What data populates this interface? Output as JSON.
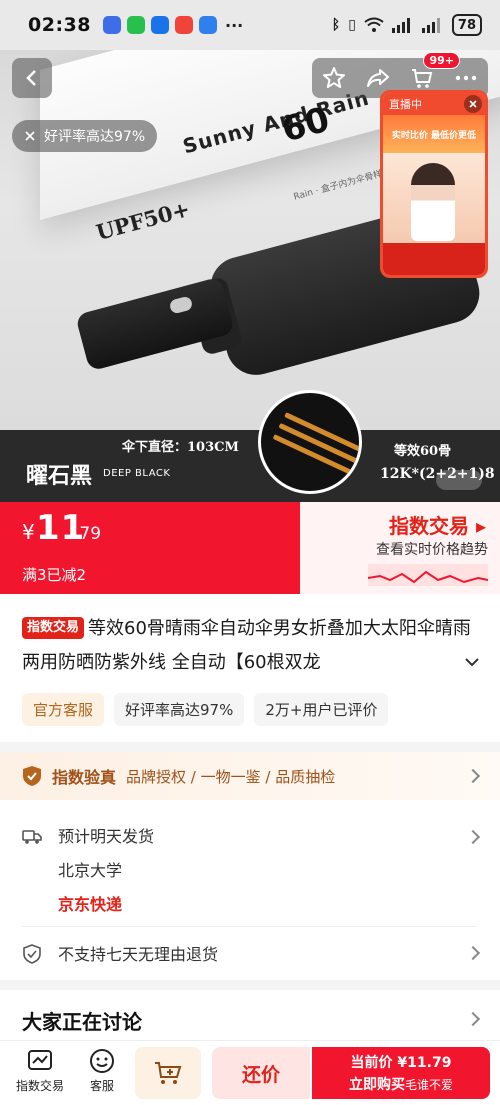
{
  "status_bar": {
    "time": "02:38",
    "battery": "78",
    "more": "···"
  },
  "hero": {
    "rating_tip": "好评率高达97%",
    "cart_badge": "99+",
    "box_brand": "UPF50+",
    "box_script": "Sunny And Rain",
    "box_number": "60",
    "box_small_text": "Rain · 盒子内为伞骨样",
    "live_label": "直播中",
    "live_banner": "实时比价 最低价更低",
    "color_name": "曜石黑",
    "color_en": "DEEP BLACK",
    "spec_diameter": "伞下直径：103CM",
    "spec_ribs": "等效60骨",
    "spec_frame": "12K*(2+2+1)8"
  },
  "price": {
    "currency": "¥",
    "integer": "11",
    "decimal": ".79",
    "promo": "满3已减2",
    "index_title": "指数交易",
    "index_sub": "查看实时价格趋势"
  },
  "product": {
    "tag": "指数交易",
    "title": "等效60骨晴雨伞自动伞男女折叠加大太阳伞晴雨两用防晒防紫外线 全自动【60根双龙",
    "chips": [
      "官方客服",
      "好评率高达97%",
      "2万+用户已评价"
    ]
  },
  "verify": {
    "title": "指数验真",
    "desc": "品牌授权 / 一物一鉴 / 品质抽检"
  },
  "shipping": {
    "line1": "预计明天发货",
    "line2": "北京大学",
    "line3": "京东快递"
  },
  "return_policy": "不支持七天无理由退货",
  "discussion_title": "大家正在讨论",
  "bottom_bar": {
    "index_trade": "指数交易",
    "service": "客服",
    "bargain": "还价",
    "current_price": "当前价 ¥11.79",
    "buy_now": "立即购买",
    "buy_overlay": "毛谁不爱"
  },
  "colors": {
    "accent": "#f1162e",
    "orange_text": "#a0521a"
  }
}
